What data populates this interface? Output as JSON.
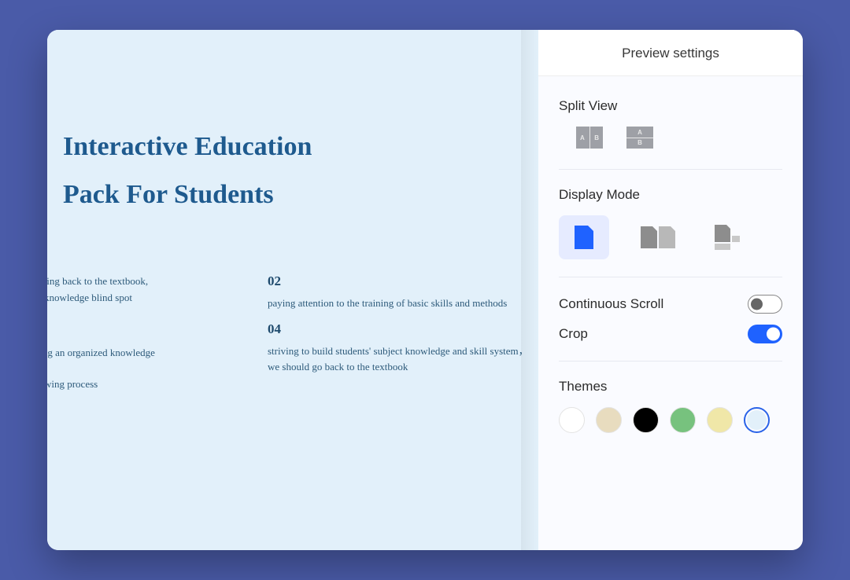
{
  "preview": {
    "title_line1": "Interactive Education",
    "title_line2": "Pack For Students",
    "items": [
      {
        "num": "",
        "desc": "on going back to the textbook,\ng no knowledge blind spot"
      },
      {
        "num": "02",
        "desc": "paying attention to the training of basic skills and methods"
      },
      {
        "num": "",
        "desc": "ructing an organized knowledge\nm.\n reviewing process"
      },
      {
        "num": "04",
        "desc": "striving to build students' subject knowledge and skill system，we should go back to the textbook"
      }
    ]
  },
  "panel": {
    "title": "Preview settings",
    "splitView": {
      "label": "Split View"
    },
    "displayMode": {
      "label": "Display Mode",
      "selected": 0
    },
    "toggles": {
      "continuousScroll": {
        "label": "Continuous Scroll",
        "value": false
      },
      "crop": {
        "label": "Crop",
        "value": true
      }
    },
    "themes": {
      "label": "Themes",
      "colors": [
        "#ffffff",
        "#e8dcbf",
        "#000000",
        "#77c27e",
        "#f0e7a8",
        "#e2f0fa"
      ],
      "selected": 5
    }
  }
}
